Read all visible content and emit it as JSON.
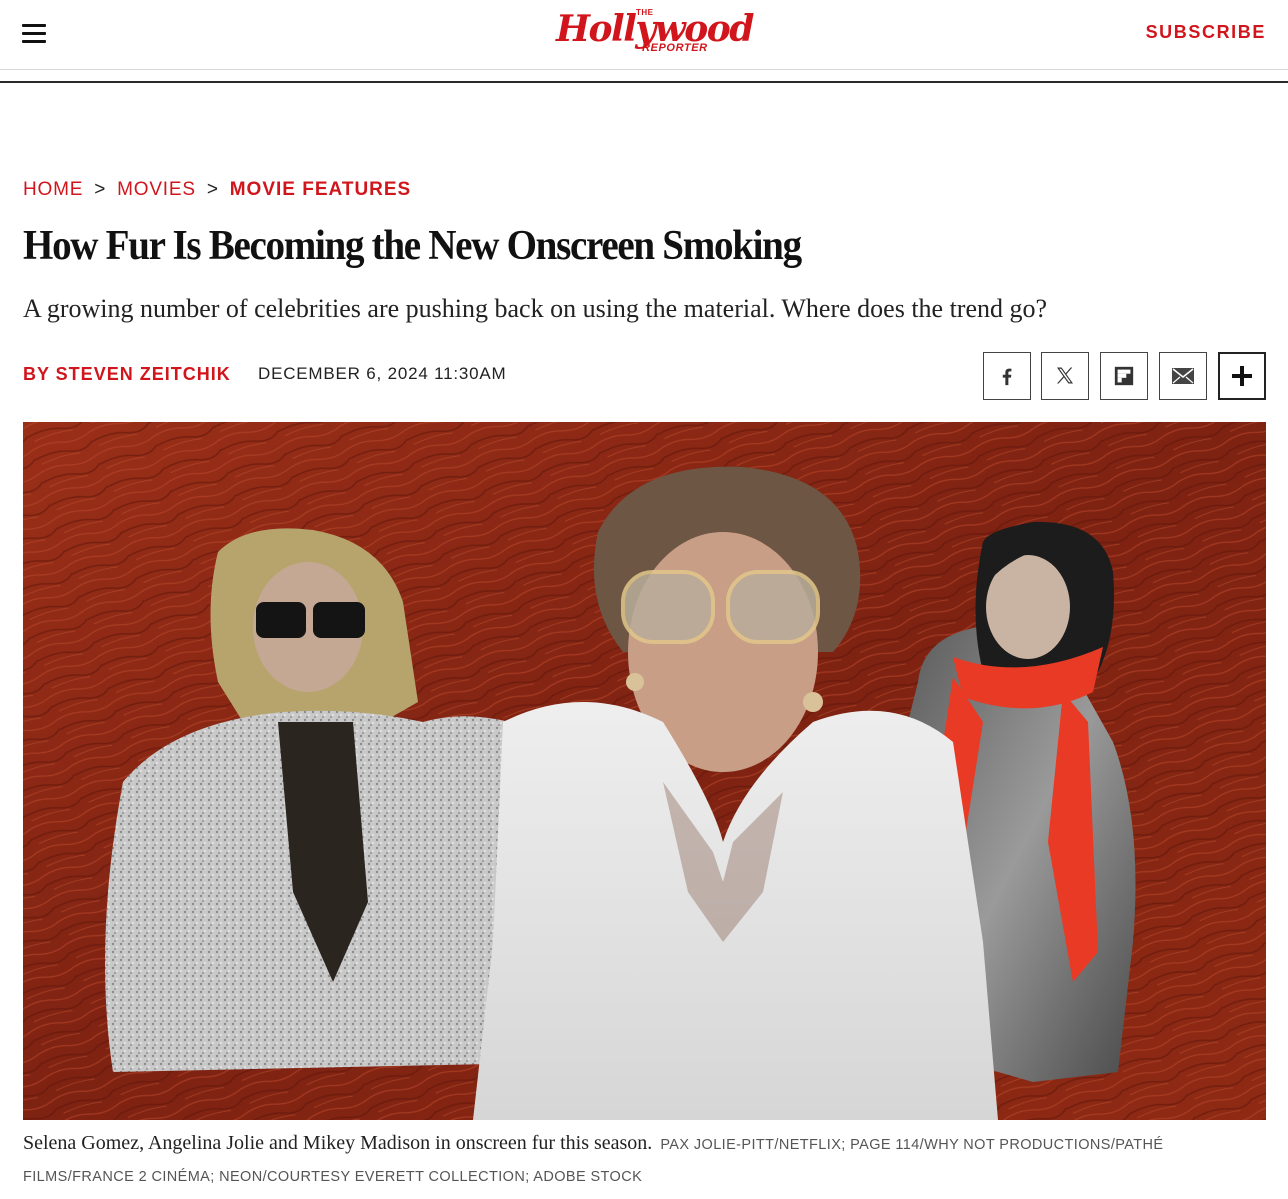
{
  "header": {
    "logo_the": "THE",
    "logo_main": "Hollywood",
    "logo_reporter": "REPORTER",
    "subscribe_label": "SUBSCRIBE",
    "menu_icon": "hamburger-menu-icon",
    "brand_color": "#d0161c"
  },
  "breadcrumb": {
    "home": "HOME",
    "movies": "MOVIES",
    "current": "MOVIE FEATURES",
    "separator": ">"
  },
  "article": {
    "headline": "How Fur Is Becoming the New Onscreen Smoking",
    "dek": "A growing number of celebrities are pushing back on using the material. Where does the trend go?",
    "byline": "BY STEVEN ZEITCHIK",
    "date": "DECEMBER 6, 2024 11:30AM"
  },
  "share": [
    {
      "icon": "facebook-icon"
    },
    {
      "icon": "x-icon"
    },
    {
      "icon": "flipboard-icon"
    },
    {
      "icon": "email-icon"
    },
    {
      "icon": "plus-icon"
    }
  ],
  "image": {
    "caption": "Selena Gomez, Angelina Jolie and Mikey Madison in onscreen fur this season.",
    "credit": "PAX JOLIE-PITT/NETFLIX; PAGE 114/WHY NOT PRODUCTIONS/PATHÉ FILMS/FRANCE 2 CINÉMA; NEON/COURTESY EVERETT COLLECTION; ADOBE STOCK",
    "background_color": "#8e2a16"
  }
}
